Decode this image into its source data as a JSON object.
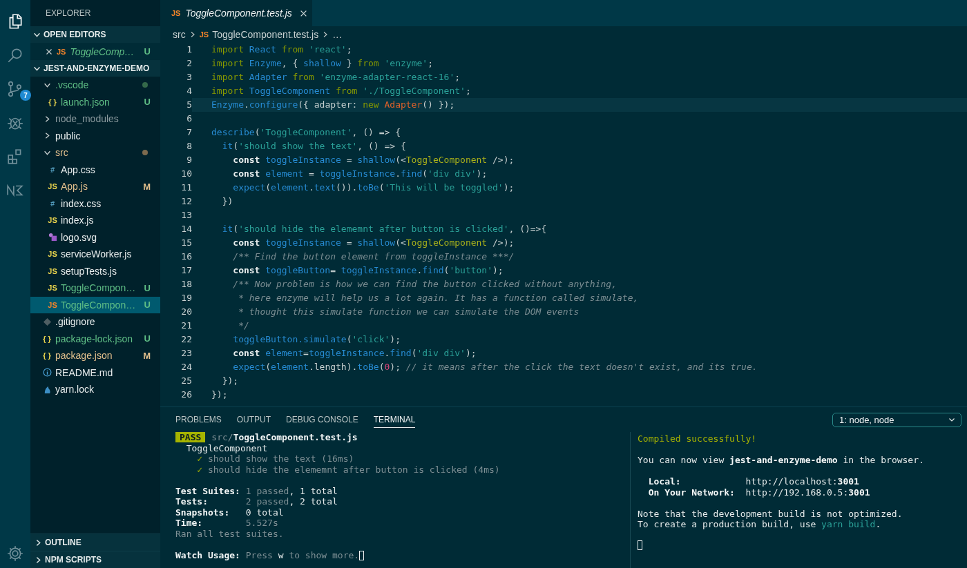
{
  "activity_bar": [
    {
      "kind": "explorer",
      "selected": true
    },
    {
      "kind": "search",
      "selected": false
    },
    {
      "kind": "source-control",
      "selected": false,
      "badge": "7"
    },
    {
      "kind": "debug",
      "selected": false
    },
    {
      "kind": "extensions",
      "selected": false
    },
    {
      "kind": "nx",
      "selected": false
    }
  ],
  "explorer": {
    "title": "EXPLORER",
    "open_editors": {
      "title": "OPEN EDITORS",
      "expanded": true,
      "items": [
        {
          "name": "ToggleComp…",
          "kind": "js-test",
          "glyph": "JS",
          "badge": "U",
          "color": "#5fbf86",
          "preview": true
        }
      ]
    },
    "project": {
      "title": "JEST-AND-ENZYME-DEMO",
      "expanded": true,
      "tree": [
        {
          "kind": "folder",
          "name": ".vscode",
          "expanded": true,
          "selected": false,
          "color": "#5fbf86",
          "dot": true,
          "children": [
            {
              "kind": "json",
              "glyph": "{ }",
              "name": "launch.json",
              "badge": "U",
              "color": "#5fbf86",
              "selected": false
            }
          ]
        },
        {
          "kind": "folder",
          "name": "node_modules",
          "expanded": false,
          "selected": false,
          "color": "#8a9a9e",
          "dot": false
        },
        {
          "kind": "folder",
          "name": "public",
          "expanded": false,
          "selected": false,
          "color": "#e6ecec",
          "dot": false
        },
        {
          "kind": "folder",
          "name": "src",
          "expanded": true,
          "selected": false,
          "color": "#e2c08d",
          "dot": true,
          "children": [
            {
              "kind": "css",
              "glyph": "#",
              "name": "App.css",
              "color": "#e6ecec",
              "selected": false
            },
            {
              "kind": "js",
              "glyph": "JS",
              "name": "App.js",
              "badge": "M",
              "color": "#e2c08d",
              "selected": false
            },
            {
              "kind": "css",
              "glyph": "#",
              "name": "index.css",
              "color": "#e6ecec",
              "selected": false
            },
            {
              "kind": "js",
              "glyph": "JS",
              "name": "index.js",
              "color": "#e6ecec",
              "selected": false
            },
            {
              "kind": "svg",
              "name": "logo.svg",
              "color": "#e6ecec",
              "selected": false
            },
            {
              "kind": "js",
              "glyph": "JS",
              "name": "serviceWorker.js",
              "color": "#e6ecec",
              "selected": false
            },
            {
              "kind": "js",
              "glyph": "JS",
              "name": "setupTests.js",
              "color": "#e6ecec",
              "selected": false
            },
            {
              "kind": "js",
              "glyph": "JS",
              "name": "ToggleCompon…",
              "badge": "U",
              "color": "#5fbf86",
              "selected": false
            },
            {
              "kind": "js-test",
              "glyph": "JS",
              "name": "ToggleCompon…",
              "badge": "U",
              "color": "#5fbf86",
              "selected": true
            }
          ]
        },
        {
          "kind": "git",
          "name": ".gitignore",
          "color": "#e6ecec",
          "selected": false
        },
        {
          "kind": "json",
          "glyph": "{ }",
          "name": "package-lock.json",
          "badge": "U",
          "color": "#5fbf86",
          "selected": false
        },
        {
          "kind": "json",
          "glyph": "{ }",
          "name": "package.json",
          "badge": "M",
          "color": "#e2c08d",
          "selected": false
        },
        {
          "kind": "info",
          "name": "README.md",
          "color": "#e6ecec",
          "selected": false
        },
        {
          "kind": "yarn",
          "name": "yarn.lock",
          "color": "#e6ecec",
          "selected": false
        }
      ]
    },
    "bottom_sections": [
      {
        "title": "OUTLINE",
        "expanded": false
      },
      {
        "title": "NPM SCRIPTS",
        "expanded": false
      }
    ]
  },
  "editor": {
    "tab": {
      "glyph": "JS",
      "title": "ToggleComponent.test.js",
      "preview": true
    },
    "breadcrumbs": [
      {
        "text": "src"
      },
      {
        "text": "ToggleComponent.test.js",
        "glyph": "JS"
      },
      {
        "text": "…"
      }
    ],
    "lines": [
      {
        "number": "1",
        "current": false,
        "tokens": [
          {
            "text": "import ",
            "kind": "kw"
          },
          {
            "text": "React",
            "kind": "id"
          },
          {
            "text": " from ",
            "kind": "kw"
          },
          {
            "text": "'react'",
            "kind": "str"
          },
          {
            "text": ";",
            "kind": "p"
          }
        ]
      },
      {
        "number": "2",
        "current": false,
        "tokens": [
          {
            "text": "import ",
            "kind": "kw"
          },
          {
            "text": "Enzyme",
            "kind": "id"
          },
          {
            "text": ", { ",
            "kind": "p"
          },
          {
            "text": "shallow",
            "kind": "id"
          },
          {
            "text": " } ",
            "kind": "p"
          },
          {
            "text": "from ",
            "kind": "kw"
          },
          {
            "text": "'enzyme'",
            "kind": "str"
          },
          {
            "text": ";",
            "kind": "p"
          }
        ]
      },
      {
        "number": "3",
        "current": false,
        "tokens": [
          {
            "text": "import ",
            "kind": "kw"
          },
          {
            "text": "Adapter",
            "kind": "id"
          },
          {
            "text": " from ",
            "kind": "kw"
          },
          {
            "text": "'enzyme-adapter-react-16'",
            "kind": "str"
          },
          {
            "text": ";",
            "kind": "p"
          }
        ]
      },
      {
        "number": "4",
        "current": false,
        "tokens": [
          {
            "text": "import ",
            "kind": "kw"
          },
          {
            "text": "ToggleComponent",
            "kind": "id"
          },
          {
            "text": " from ",
            "kind": "kw"
          },
          {
            "text": "'./ToggleComponent'",
            "kind": "str"
          },
          {
            "text": ";",
            "kind": "p"
          }
        ]
      },
      {
        "number": "5",
        "current": true,
        "tokens": [
          {
            "text": "Enzyme",
            "kind": "id"
          },
          {
            "text": ".",
            "kind": "p"
          },
          {
            "text": "configure",
            "kind": "id"
          },
          {
            "text": "({ adapter: ",
            "kind": "p"
          },
          {
            "text": "new ",
            "kind": "kw"
          },
          {
            "text": "Adapter",
            "kind": "cls"
          },
          {
            "text": "() });",
            "kind": "p"
          }
        ]
      },
      {
        "number": "6",
        "current": false
      },
      {
        "number": "7",
        "current": false,
        "tokens": [
          {
            "text": "describe",
            "kind": "id"
          },
          {
            "text": "(",
            "kind": "p"
          },
          {
            "text": "'ToggleComponent'",
            "kind": "str"
          },
          {
            "text": ", () => {",
            "kind": "p"
          }
        ]
      },
      {
        "number": "8",
        "current": false,
        "tokens": [
          {
            "text": "  it",
            "kind": "id"
          },
          {
            "text": "(",
            "kind": "p"
          },
          {
            "text": "'should show the text'",
            "kind": "str"
          },
          {
            "text": ", () => {",
            "kind": "p"
          }
        ]
      },
      {
        "number": "9",
        "current": false,
        "tokens": [
          {
            "text": "    const ",
            "kind": "decl"
          },
          {
            "text": "toggleInstance",
            "kind": "id"
          },
          {
            "text": " = ",
            "kind": "p"
          },
          {
            "text": "shallow",
            "kind": "id"
          },
          {
            "text": "(<",
            "kind": "p"
          },
          {
            "text": "ToggleComponent",
            "kind": "jsx"
          },
          {
            "text": " />);",
            "kind": "p"
          }
        ]
      },
      {
        "number": "10",
        "current": false,
        "tokens": [
          {
            "text": "    const ",
            "kind": "decl"
          },
          {
            "text": "element",
            "kind": "id"
          },
          {
            "text": " = ",
            "kind": "p"
          },
          {
            "text": "toggleInstance",
            "kind": "id"
          },
          {
            "text": ".",
            "kind": "p"
          },
          {
            "text": "find",
            "kind": "id"
          },
          {
            "text": "(",
            "kind": "p"
          },
          {
            "text": "'div div'",
            "kind": "str"
          },
          {
            "text": ");",
            "kind": "p"
          }
        ]
      },
      {
        "number": "11",
        "current": false,
        "tokens": [
          {
            "text": "    expect",
            "kind": "id"
          },
          {
            "text": "(",
            "kind": "p"
          },
          {
            "text": "element",
            "kind": "id"
          },
          {
            "text": ".",
            "kind": "p"
          },
          {
            "text": "text",
            "kind": "id"
          },
          {
            "text": "()).",
            "kind": "p"
          },
          {
            "text": "toBe",
            "kind": "id"
          },
          {
            "text": "(",
            "kind": "p"
          },
          {
            "text": "'This will be toggled'",
            "kind": "str"
          },
          {
            "text": ");",
            "kind": "p"
          }
        ]
      },
      {
        "number": "12",
        "current": false,
        "tokens": [
          {
            "text": "  })",
            "kind": "p"
          }
        ]
      },
      {
        "number": "13",
        "current": false
      },
      {
        "number": "14",
        "current": false,
        "tokens": [
          {
            "text": "  it",
            "kind": "id"
          },
          {
            "text": "(",
            "kind": "p"
          },
          {
            "text": "'should hide the elememnt after button is clicked'",
            "kind": "str"
          },
          {
            "text": ", ()=>{",
            "kind": "p"
          }
        ]
      },
      {
        "number": "15",
        "current": false,
        "tokens": [
          {
            "text": "    const ",
            "kind": "decl"
          },
          {
            "text": "toggleInstance",
            "kind": "id"
          },
          {
            "text": " = ",
            "kind": "p"
          },
          {
            "text": "shallow",
            "kind": "id"
          },
          {
            "text": "(<",
            "kind": "p"
          },
          {
            "text": "ToggleComponent",
            "kind": "jsx"
          },
          {
            "text": " />);",
            "kind": "p"
          }
        ]
      },
      {
        "number": "16",
        "current": false,
        "tokens": [
          {
            "text": "    /** Find the button element from toggleInstance ***/",
            "kind": "cm"
          }
        ]
      },
      {
        "number": "17",
        "current": false,
        "tokens": [
          {
            "text": "    const ",
            "kind": "decl"
          },
          {
            "text": "toggleButton",
            "kind": "id"
          },
          {
            "text": "= ",
            "kind": "p"
          },
          {
            "text": "toggleInstance",
            "kind": "id"
          },
          {
            "text": ".",
            "kind": "p"
          },
          {
            "text": "find",
            "kind": "id"
          },
          {
            "text": "(",
            "kind": "p"
          },
          {
            "text": "'button'",
            "kind": "str"
          },
          {
            "text": ");",
            "kind": "p"
          }
        ]
      },
      {
        "number": "18",
        "current": false,
        "tokens": [
          {
            "text": "    /** Now problem is how we can find the button clicked without anything,",
            "kind": "cm"
          }
        ]
      },
      {
        "number": "19",
        "current": false,
        "tokens": [
          {
            "text": "     * here enzyme will help us a lot again. It has a function called simulate,",
            "kind": "cm"
          }
        ]
      },
      {
        "number": "20",
        "current": false,
        "tokens": [
          {
            "text": "     * thought this simulate function we can simulate the DOM events",
            "kind": "cm"
          }
        ]
      },
      {
        "number": "21",
        "current": false,
        "tokens": [
          {
            "text": "     */",
            "kind": "cm"
          }
        ]
      },
      {
        "number": "22",
        "current": false,
        "tokens": [
          {
            "text": "    toggleButton",
            "kind": "id"
          },
          {
            "text": ".simulate",
            "kind": "id"
          },
          {
            "text": "(",
            "kind": "p"
          },
          {
            "text": "'click'",
            "kind": "str"
          },
          {
            "text": ");",
            "kind": "p"
          }
        ]
      },
      {
        "number": "23",
        "current": false,
        "tokens": [
          {
            "text": "    const ",
            "kind": "decl"
          },
          {
            "text": "element",
            "kind": "id"
          },
          {
            "text": "=",
            "kind": "p"
          },
          {
            "text": "toggleInstance",
            "kind": "id"
          },
          {
            "text": ".",
            "kind": "p"
          },
          {
            "text": "find",
            "kind": "id"
          },
          {
            "text": "(",
            "kind": "p"
          },
          {
            "text": "'div div'",
            "kind": "str"
          },
          {
            "text": ");",
            "kind": "p"
          }
        ]
      },
      {
        "number": "24",
        "current": false,
        "tokens": [
          {
            "text": "    expect",
            "kind": "id"
          },
          {
            "text": "(",
            "kind": "p"
          },
          {
            "text": "element",
            "kind": "id"
          },
          {
            "text": ".length).",
            "kind": "p"
          },
          {
            "text": "toBe",
            "kind": "id"
          },
          {
            "text": "(",
            "kind": "p"
          },
          {
            "text": "0",
            "kind": "num"
          },
          {
            "text": "); ",
            "kind": "p"
          },
          {
            "text": "// it means after the click the text doesn't exist, and its true.",
            "kind": "cm"
          }
        ]
      },
      {
        "number": "25",
        "current": false,
        "tokens": [
          {
            "text": "  });",
            "kind": "p"
          }
        ]
      },
      {
        "number": "26",
        "current": false,
        "tokens": [
          {
            "text": "});",
            "kind": "p"
          }
        ]
      }
    ]
  },
  "panel": {
    "tabs": [
      {
        "label": "PROBLEMS",
        "selected": false
      },
      {
        "label": "OUTPUT",
        "selected": false
      },
      {
        "label": "DEBUG CONSOLE",
        "selected": false
      },
      {
        "label": "TERMINAL",
        "selected": true
      }
    ],
    "terminal_select": "1: node, node",
    "left_terminal": [
      {
        "lines": [
          [
            {
              "text": "PASS",
              "kind": "badge"
            },
            {
              "text": "src/",
              "kind": "dim"
            },
            {
              "text": "ToggleComponent.test.js",
              "kind": "bold"
            }
          ],
          [
            {
              "text": "  ToggleComponent",
              "kind": "plain"
            }
          ],
          [
            {
              "text": "    ✓ ",
              "kind": "check"
            },
            {
              "text": "should show the text (16ms)",
              "kind": "dim"
            }
          ],
          [
            {
              "text": "    ✓ ",
              "kind": "check"
            },
            {
              "text": "should hide the elememnt after button is clicked (4ms)",
              "kind": "dim"
            }
          ]
        ]
      },
      {
        "lines": [
          [
            {
              "text": "Test Suites: ",
              "kind": "bold"
            },
            {
              "text": "1 passed",
              "kind": "dim"
            },
            {
              "text": ", 1 total",
              "kind": "plain"
            }
          ],
          [
            {
              "text": "Tests:       ",
              "kind": "bold"
            },
            {
              "text": "2 passed",
              "kind": "dim"
            },
            {
              "text": ", 2 total",
              "kind": "plain"
            }
          ],
          [
            {
              "text": "Snapshots:   ",
              "kind": "bold"
            },
            {
              "text": "0 total",
              "kind": "plain"
            }
          ],
          [
            {
              "text": "Time:        ",
              "kind": "bold"
            },
            {
              "text": "5.527s",
              "kind": "dim"
            }
          ],
          [
            {
              "text": "Ran all test suites.",
              "kind": "dim"
            }
          ]
        ]
      },
      {
        "lines": [
          [
            {
              "text": "Watch Usage: ",
              "kind": "bold"
            },
            {
              "text": "Press ",
              "kind": "dim"
            },
            {
              "text": "w",
              "kind": "plain"
            },
            {
              "text": " to show more.",
              "kind": "dim"
            }
          ]
        ]
      }
    ],
    "right_terminal": [
      {
        "lines": [
          [
            {
              "text": "Compiled successfully!",
              "kind": "yellow"
            }
          ]
        ]
      },
      {
        "lines": [
          [
            {
              "text": "You can now view ",
              "kind": "plain"
            },
            {
              "text": "jest-and-enzyme-demo",
              "kind": "bold"
            },
            {
              "text": " in the browser.",
              "kind": "plain"
            }
          ]
        ]
      },
      {
        "lines": [
          [
            {
              "text": "  Local:            ",
              "kind": "bold"
            },
            {
              "text": "http://localhost:",
              "kind": "plain"
            },
            {
              "text": "3001",
              "kind": "bold"
            }
          ],
          [
            {
              "text": "  On Your Network:  ",
              "kind": "bold"
            },
            {
              "text": "http://192.168.0.5:",
              "kind": "plain"
            },
            {
              "text": "3001",
              "kind": "bold"
            }
          ]
        ]
      },
      {
        "lines": [
          [
            {
              "text": "Note that the development build is not optimized.",
              "kind": "plain"
            }
          ],
          [
            {
              "text": "To create a production build, use ",
              "kind": "plain"
            },
            {
              "text": "yarn build",
              "kind": "cyan"
            },
            {
              "text": ".",
              "kind": "plain"
            }
          ]
        ]
      }
    ]
  }
}
